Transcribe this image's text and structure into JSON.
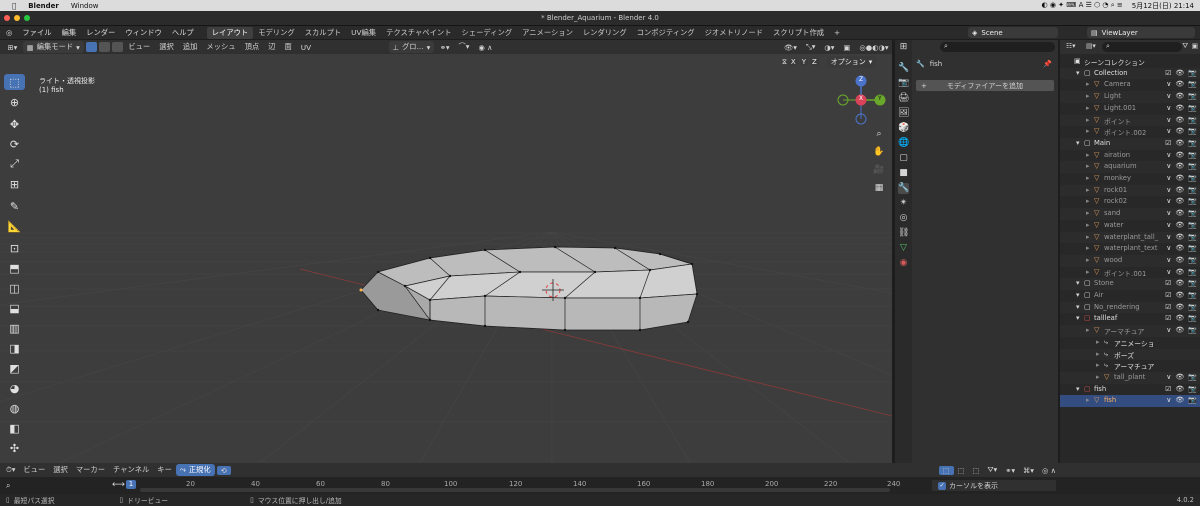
{
  "mac_menu": {
    "app": "Blender",
    "window": "Window",
    "datetime": "5月12日(日)  21:14"
  },
  "window_title": "* Blender_Aquarium - Blender 4.0",
  "menus": [
    "ファイル",
    "編集",
    "レンダー",
    "ウィンドウ",
    "ヘルプ"
  ],
  "workspaces": [
    "レイアウト",
    "モデリング",
    "スカルプト",
    "UV編集",
    "テクスチャペイント",
    "シェーディング",
    "アニメーション",
    "レンダリング",
    "コンポジティング",
    "ジオメトリノード",
    "スクリプト作成"
  ],
  "workspace_add": "+",
  "scene": "Scene",
  "view_layer": "ViewLayer",
  "viewport_header": {
    "mode": "編集モード",
    "menu_items": [
      "ビュー",
      "選択",
      "追加",
      "メッシュ",
      "頂点",
      "辺",
      "面",
      "UV"
    ],
    "transform": "グロ...",
    "options": "オプション",
    "axes": [
      "X",
      "Y",
      "Z"
    ]
  },
  "overlay_text": {
    "view_name": "ライト・透視投影",
    "object": "(1) fish"
  },
  "gizmo": {
    "z": "Z",
    "x": "X",
    "y": "Y"
  },
  "properties": {
    "search_placeholder": "",
    "object_name": "fish",
    "add_modifier": "モディファイアーを追加"
  },
  "outliner": {
    "search_placeholder": "",
    "rows": [
      {
        "label": "シーンコレクション",
        "indent": 0,
        "kind": "scene"
      },
      {
        "label": "Collection",
        "indent": 1,
        "kind": "coll"
      },
      {
        "label": "Camera",
        "indent": 2,
        "kind": "obj",
        "dim": true
      },
      {
        "label": "Light",
        "indent": 2,
        "kind": "obj",
        "dim": true
      },
      {
        "label": "Light.001",
        "indent": 2,
        "kind": "obj",
        "dim": true
      },
      {
        "label": "ポイント",
        "indent": 2,
        "kind": "obj",
        "dim": true
      },
      {
        "label": "ポイント.002",
        "indent": 2,
        "kind": "obj",
        "dim": true
      },
      {
        "label": "Main",
        "indent": 1,
        "kind": "coll"
      },
      {
        "label": "airation",
        "indent": 2,
        "kind": "obj",
        "dim": true
      },
      {
        "label": "aquarium",
        "indent": 2,
        "kind": "obj",
        "dim": true
      },
      {
        "label": "monkey",
        "indent": 2,
        "kind": "obj",
        "dim": true
      },
      {
        "label": "rock01",
        "indent": 2,
        "kind": "obj",
        "dim": true
      },
      {
        "label": "rock02",
        "indent": 2,
        "kind": "obj",
        "dim": true
      },
      {
        "label": "sand",
        "indent": 2,
        "kind": "obj",
        "dim": true
      },
      {
        "label": "water",
        "indent": 2,
        "kind": "obj",
        "dim": true
      },
      {
        "label": "waterplant_tall_",
        "indent": 2,
        "kind": "obj",
        "dim": true
      },
      {
        "label": "waterplant_text",
        "indent": 2,
        "kind": "obj",
        "dim": true
      },
      {
        "label": "wood",
        "indent": 2,
        "kind": "obj",
        "dim": true
      },
      {
        "label": "ポイント.001",
        "indent": 2,
        "kind": "obj",
        "dim": true
      },
      {
        "label": "Stone",
        "indent": 1,
        "kind": "coll",
        "dim": true
      },
      {
        "label": "Air",
        "indent": 1,
        "kind": "coll",
        "dim": true
      },
      {
        "label": "No_rendering",
        "indent": 1,
        "kind": "coll",
        "dim": true
      },
      {
        "label": "tallleaf",
        "indent": 1,
        "kind": "coll"
      },
      {
        "label": "アーマチュア",
        "indent": 2,
        "kind": "obj",
        "dim": true
      },
      {
        "label": "アニメーショ",
        "indent": 3,
        "kind": "sub"
      },
      {
        "label": "ポーズ",
        "indent": 3,
        "kind": "sub"
      },
      {
        "label": "アーマチュア",
        "indent": 3,
        "kind": "sub"
      },
      {
        "label": "tall_plant",
        "indent": 3,
        "kind": "obj",
        "dim": true
      },
      {
        "label": "fish",
        "indent": 1,
        "kind": "coll"
      },
      {
        "label": "fish",
        "indent": 2,
        "kind": "obj",
        "selected": true
      }
    ]
  },
  "timeline": {
    "menu_items": [
      "ビュー",
      "選択",
      "マーカー",
      "チャンネル",
      "キー"
    ],
    "normalize": "正規化",
    "current_frame": "1",
    "ticks": [
      "20",
      "40",
      "60",
      "80",
      "100",
      "120",
      "140",
      "160",
      "180",
      "200",
      "220",
      "240"
    ],
    "show_cursor": "カーソルを表示"
  },
  "status": {
    "left": "最短パス選択",
    "mid": "ドリービュー",
    "right": "マウス位置に押し出し/追加",
    "version": "4.0.2"
  },
  "colors": {
    "accent": "#4772b3",
    "header": "#303030",
    "viewport": "#3d3d3d",
    "outliner_bg": "#282828",
    "selection": "#334d80"
  }
}
